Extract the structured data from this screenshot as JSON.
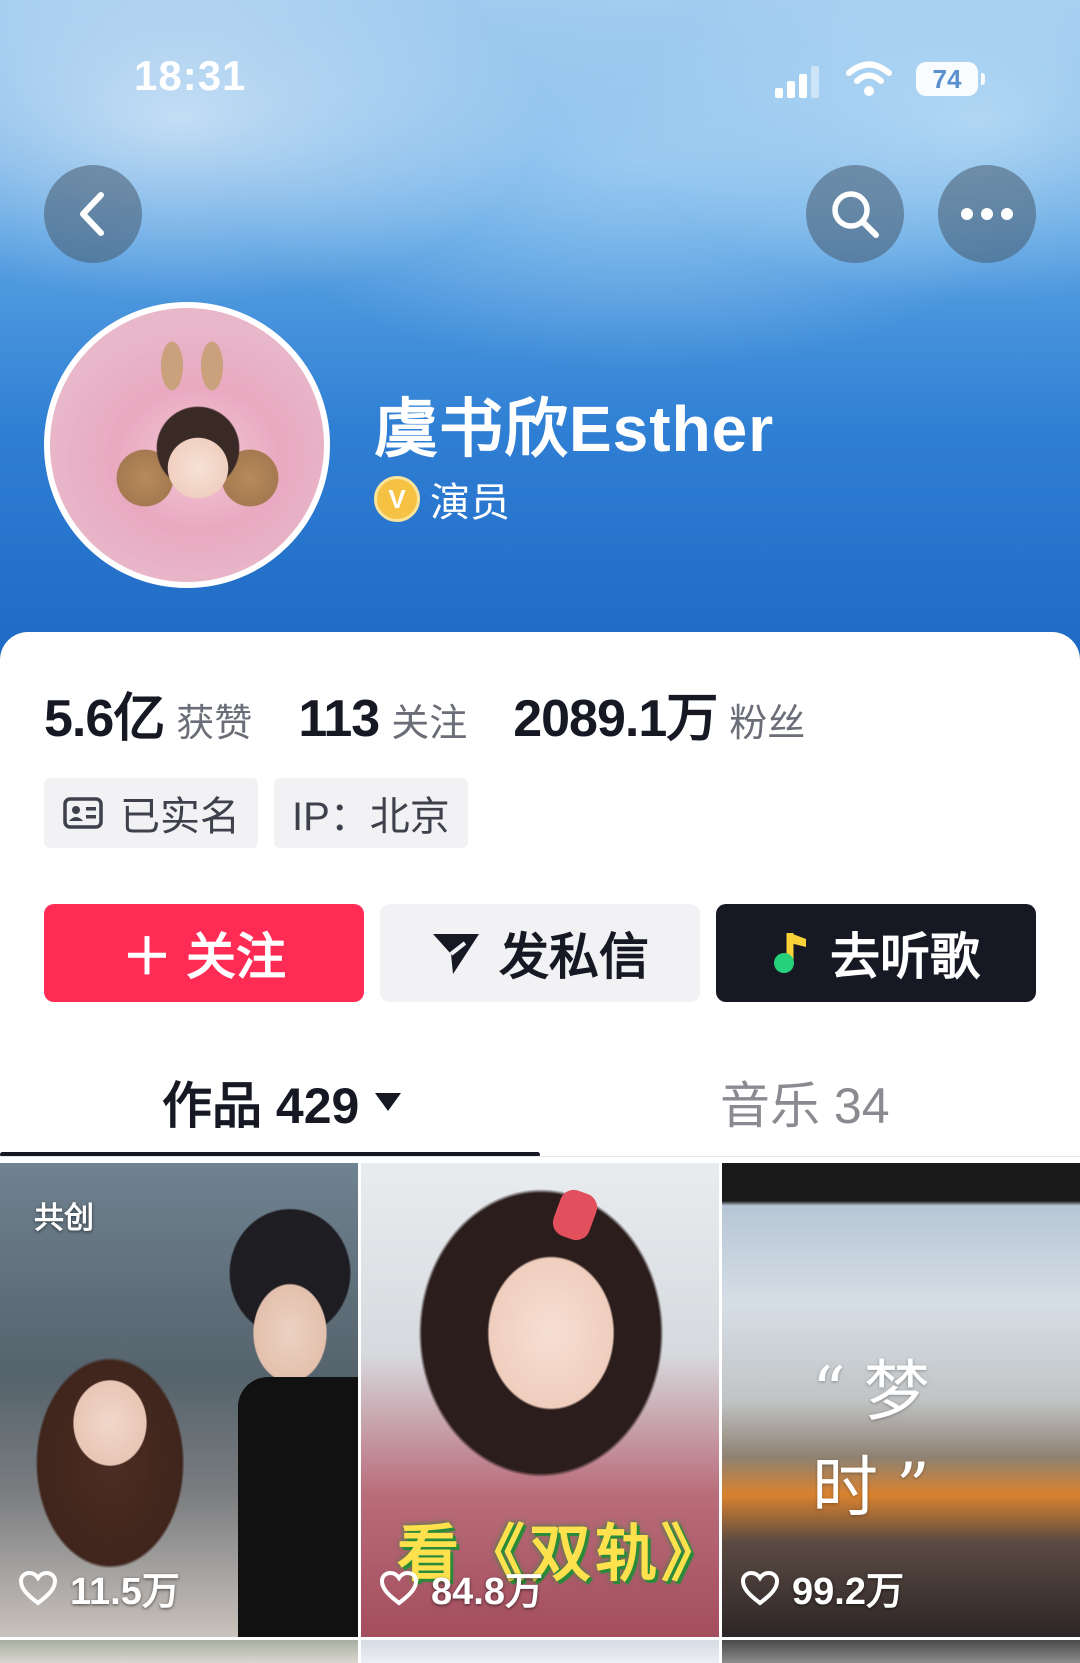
{
  "status_bar": {
    "time": "18:31",
    "battery": "74"
  },
  "profile": {
    "nickname": "虞书欣Esther",
    "verify_badge": "V",
    "verify_text": "演员"
  },
  "stats": [
    {
      "num": "5.6亿",
      "label": "获赞"
    },
    {
      "num": "113",
      "label": "关注"
    },
    {
      "num": "2089.1万",
      "label": "粉丝"
    }
  ],
  "tags": {
    "real_name": "已实名",
    "ip": "IP：北京"
  },
  "actions": {
    "follow": "＋ 关注",
    "message": "发私信",
    "music": "去听歌"
  },
  "tabs": {
    "works": "作品 429",
    "music": "音乐 34"
  },
  "videos": [
    {
      "label": "共创",
      "likes": "11.5万"
    },
    {
      "overlay": "看《双轨》",
      "likes": "84.8万"
    },
    {
      "overlay": "“梦 时”",
      "likes": "99.2万"
    }
  ],
  "colors": {
    "accent": "#fe2c55",
    "dark_button": "#161823",
    "verify": "#f6c244"
  },
  "icons": [
    "back-icon",
    "search-icon",
    "more-icon",
    "id-card-icon",
    "send-icon",
    "music-note-icon",
    "caret-down-icon",
    "heart-icon"
  ]
}
